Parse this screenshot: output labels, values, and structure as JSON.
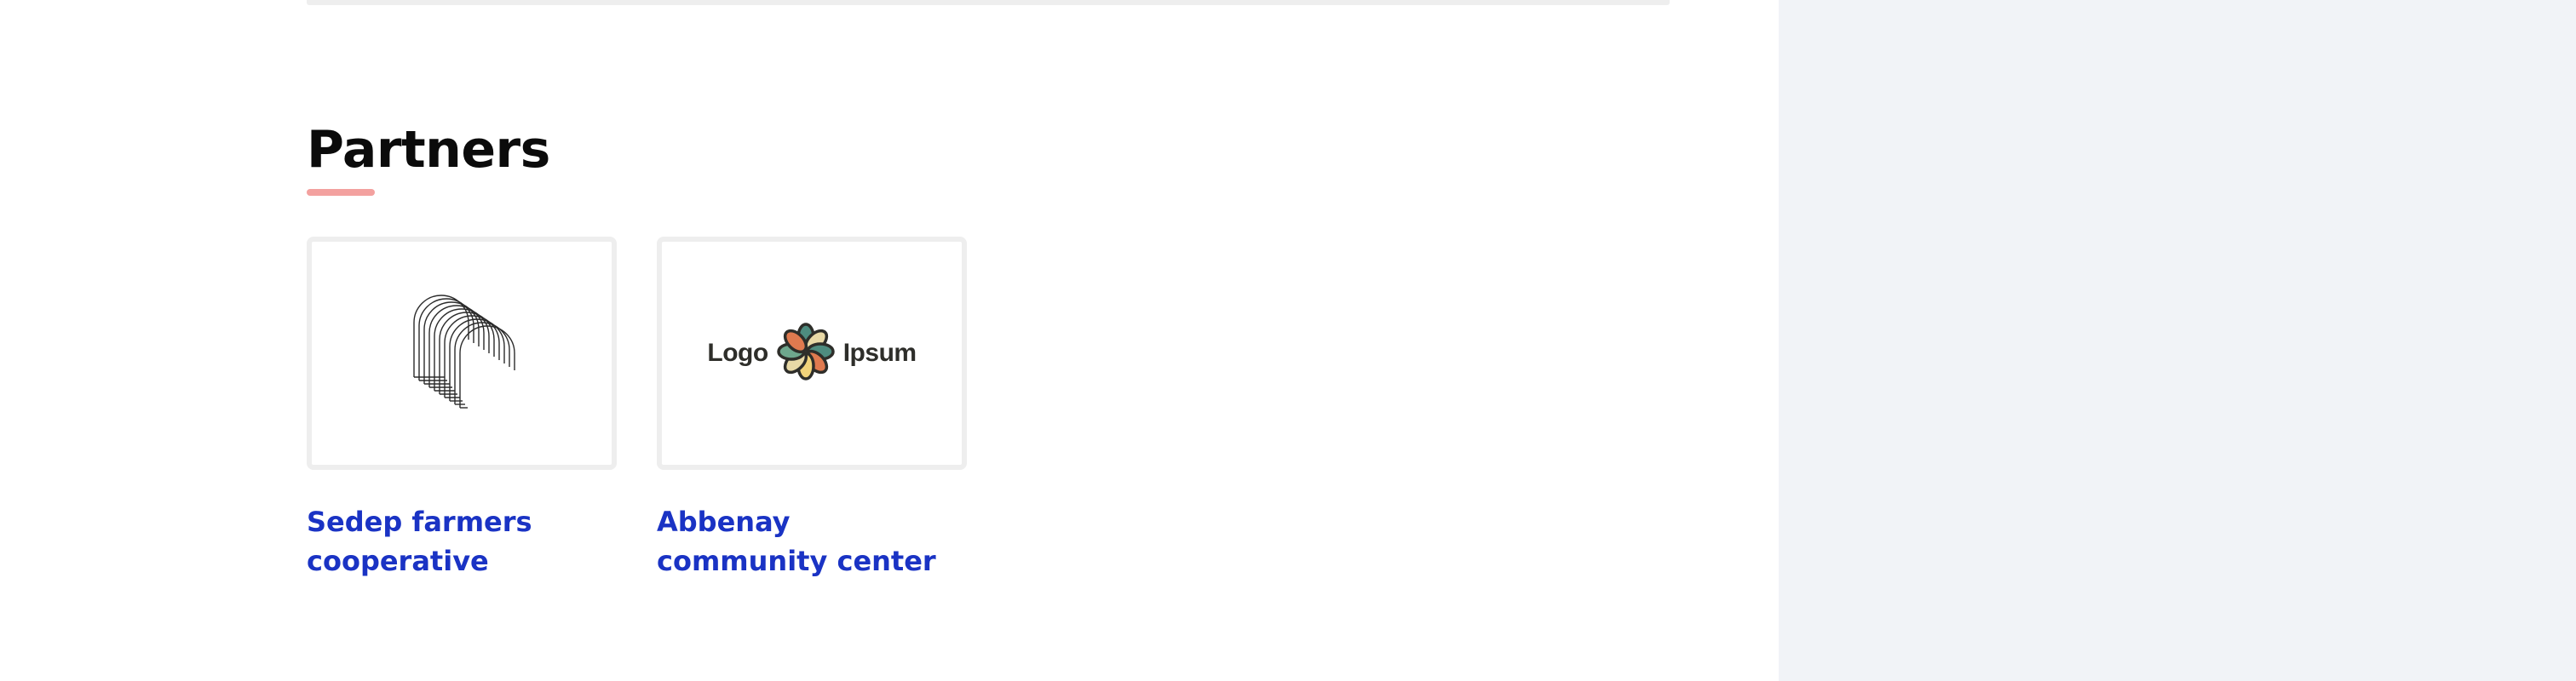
{
  "section": {
    "title": "Partners"
  },
  "partners": [
    {
      "name": "Sedep farmers cooperative",
      "logo_icon": "concentric-arches-logo-icon"
    },
    {
      "name": "Abbenay community center",
      "logo_icon": "flower-logo-icon",
      "logo_text_left": "Logo",
      "logo_text_right": "Ipsum"
    }
  ],
  "colors": {
    "link": "#1a33c4",
    "accent_underline": "#f3a19f",
    "sidebar_bg": "#f1f3f7",
    "card_border": "#eeeeee"
  }
}
